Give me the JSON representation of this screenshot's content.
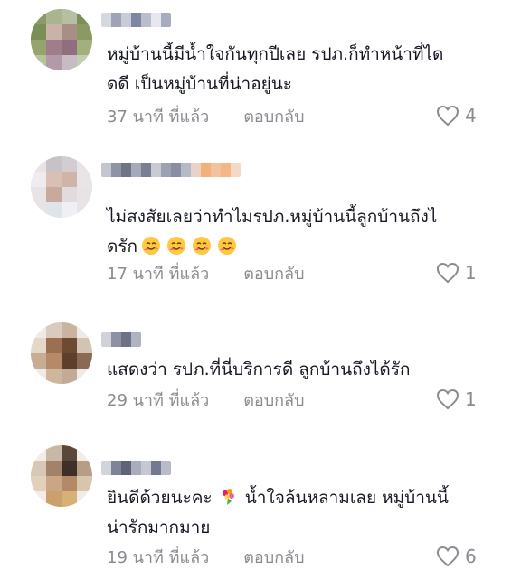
{
  "comments": [
    {
      "text": "หมู่บ้านนี้มีน้ำใจกันทุกปีเลย รปภ.ก็ทำหน้าที่ได\nดดี เป็นหมู่บ้านที่น่าอยู่นะ",
      "time": "37 นาที ที่แล้ว",
      "reply": "ตอบกลับ",
      "likes": "4",
      "emojis": 0
    },
    {
      "text": "ไม่สงสัยเลยว่าทำไมรปภ.หมู่บ้านนี้ลูกบ้านถึงไ",
      "text_line2": "ดรัก",
      "time": "17 นาที ที่แล้ว",
      "reply": "ตอบกลับ",
      "likes": "1",
      "emojis": 4
    },
    {
      "text": "แสดงว่า รปภ.ที่นี่บริการดี ลูกบ้านถึงได้รัก",
      "time": "29 นาที ที่แล้ว",
      "reply": "ตอบกลับ",
      "likes": "1",
      "emojis": 0
    },
    {
      "text": "ยินดีด้วยนะคะ",
      "text_after_emoji": " น้ำใจล้นหลามเลย หมู่บ้านนี้",
      "text_line2": "น่ารักมากมาย",
      "time": "19 นาที ที่แล้ว",
      "reply": "ตอบกลับ",
      "likes": "6",
      "emojis": 0
    }
  ],
  "icons": {
    "like": "heart-outline-icon",
    "hug_emoji": "hugging-face-emoji",
    "bouquet_emoji": "bouquet-emoji"
  },
  "colors": {
    "text": "#161823",
    "secondary": "#8a8b91"
  }
}
